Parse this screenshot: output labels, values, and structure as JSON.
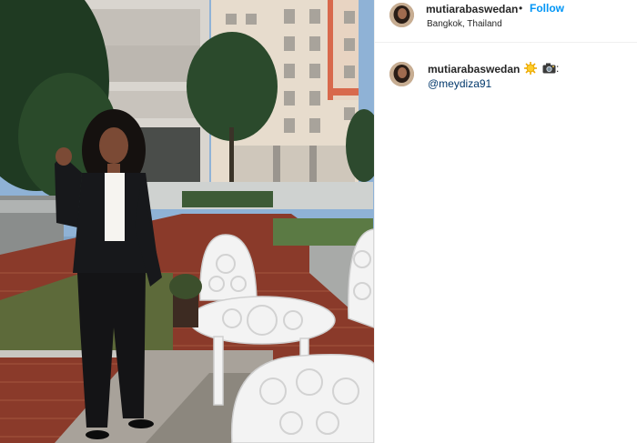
{
  "post": {
    "username": "mutiarabaswedan",
    "separator": "•",
    "follow_label": "Follow",
    "location": "Bangkok, Thailand",
    "caption": {
      "username": "mutiarabaswedan",
      "emojis": [
        "sun-emoji",
        "camera-emoji"
      ],
      "colon": ":",
      "mention": "@meydiza91"
    },
    "colors": {
      "follow": "#0095f6",
      "mention": "#00376b",
      "text": "#262626"
    }
  }
}
